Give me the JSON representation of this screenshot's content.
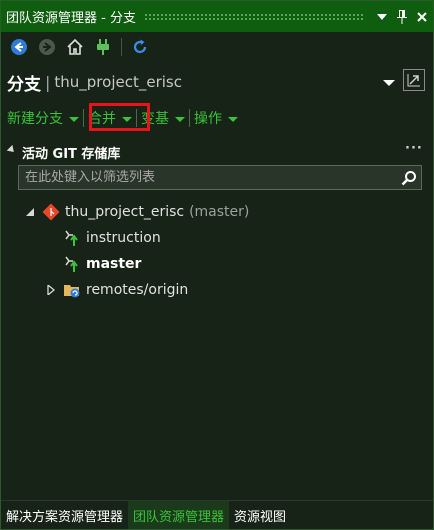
{
  "window": {
    "title": "团队资源管理器 - 分支",
    "dropdown_glyph": "▼",
    "pin_glyph": "⊥",
    "close_glyph": "✕"
  },
  "toolbar": {
    "back_icon": "back-arrow-icon",
    "forward_icon": "forward-arrow-icon",
    "home_icon": "home-icon",
    "connect_icon": "plug-icon",
    "refresh_icon": "refresh-icon"
  },
  "header": {
    "page_title": "分支",
    "separator": "|",
    "repo_name": "thu_project_erisc"
  },
  "actions": {
    "new_branch": "新建分支",
    "merge": "合并",
    "rebase": "变基",
    "operations": "操作"
  },
  "section": {
    "title": "活动 GIT 存储库",
    "more": "···"
  },
  "search": {
    "placeholder": "在此处键入以筛选列表",
    "value": ""
  },
  "tree": {
    "repo": {
      "name": "thu_project_erisc",
      "current_branch": "(master)"
    },
    "branches": [
      {
        "name": "instruction",
        "current": false
      },
      {
        "name": "master",
        "current": true
      }
    ],
    "remotes": {
      "name": "remotes/origin"
    }
  },
  "tabs": [
    {
      "label": "解决方案资源管理器",
      "active": false
    },
    {
      "label": "团队资源管理器",
      "active": true
    },
    {
      "label": "资源视图",
      "active": false
    }
  ],
  "colors": {
    "accent": "#3bc23b",
    "titlebar": "#0f5d0f",
    "highlight_box": "#e8141a",
    "background": "#162316"
  }
}
